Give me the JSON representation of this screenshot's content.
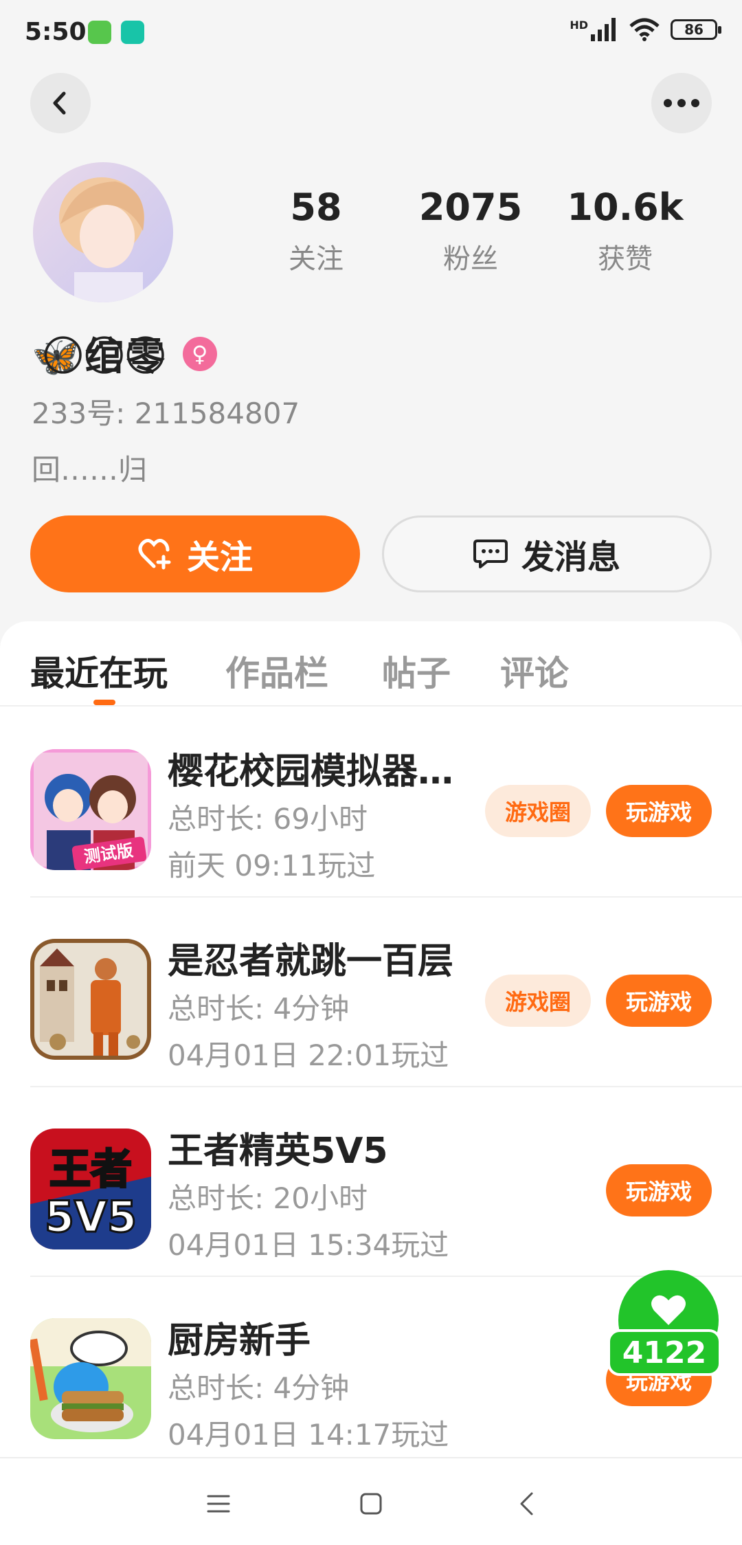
{
  "status_bar": {
    "time": "5:50",
    "network": "HD",
    "battery": "86"
  },
  "profile": {
    "name": "🦋⃝绾⃝零⃝",
    "gender_symbol": "♀",
    "id": "233号: 211584807",
    "bio": "回……归",
    "stats": [
      {
        "value": "58",
        "label": "关注"
      },
      {
        "value": "2075",
        "label": "粉丝"
      },
      {
        "value": "10.6k",
        "label": "获赞"
      }
    ],
    "follow_label": "关注",
    "message_label": "发消息"
  },
  "tabs": [
    "最近在玩",
    "作品栏",
    "帖子",
    "评论"
  ],
  "games": [
    {
      "name": "樱花校园模拟器…",
      "duration": "总时长: 69小时",
      "last_played": "前天 09:11玩过",
      "circle_label": "游戏圈",
      "play_label": "玩游戏",
      "icon_text": "测试版"
    },
    {
      "name": "是忍者就跳一百层",
      "duration": "总时长: 4分钟",
      "last_played": "04月01日 22:01玩过",
      "circle_label": "游戏圈",
      "play_label": "玩游戏"
    },
    {
      "name": "王者精英5V5",
      "duration": "总时长: 20小时",
      "last_played": "04月01日 15:34玩过",
      "play_label": "玩游戏",
      "icon_text": "王者 5V5"
    },
    {
      "name": "厨房新手",
      "duration": "总时长: 4分钟",
      "last_played": "04月01日 14:17玩过",
      "play_label": "玩游戏"
    }
  ],
  "floating_like": {
    "count": "4122"
  },
  "colors": {
    "accent": "#ff7318",
    "like_green": "#22c42a",
    "gender_pink": "#f36b9b"
  }
}
